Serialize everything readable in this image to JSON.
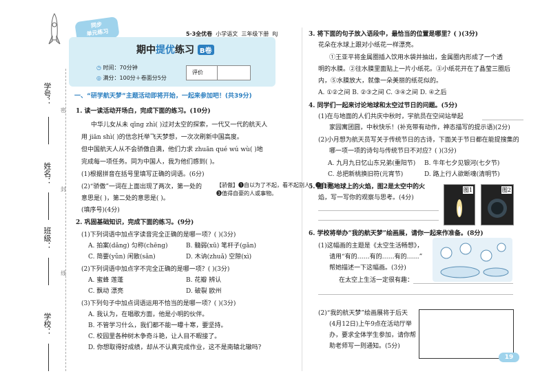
{
  "binding": {
    "student_no": "学号：",
    "name": "姓名：",
    "class": "班级：",
    "school": "学校：",
    "cut_marks": [
      "密",
      "封",
      "线"
    ]
  },
  "header": {
    "badge_line1": "同步",
    "badge_line2": "单元练习",
    "book": "5·3全优卷",
    "subject": "小学语文",
    "grade": "三年级下册",
    "edition": "RJ",
    "title_pre": "期中",
    "title_hl": "提优",
    "title_post": "练习",
    "tag": "B卷",
    "time": "时间：70分钟",
    "score": "满分：100分＋卷面分5分",
    "rating_label": "评价"
  },
  "section": {
    "title": "一、“研学航天梦”主题活动即将开始，一起来参加吧！(共39分)"
  },
  "q1": {
    "stem": "1. 读一读活动开场白，完成下面的练习。(10分)",
    "p1": "中华儿女从未 qīng zhì(        )过对太空的探索，一代又一代的航天人",
    "p2": "用 jiān shì(        )的信念托举飞天梦想，一次次刷新中国高度。",
    "p3": "但中国航天人从不会骄傲自满，他们力求 zhuān qué wú wù(        )地",
    "p4": "完成每一项任务。同为中国人，我为他们感到(        )。",
    "s1": "(1)根据拼音在括号里填写正确的词语。(6分)",
    "s2a": "(2)“骄傲”一词在上面出现了两次，第一处的",
    "s2b": "意思是(     )，第二处的意思是(     )。",
    "s2c": "(填序号)(4分)",
    "s2d": "【骄傲】❶自以为了不起，看不起别人；❷自豪；",
    "s2e": "❸值得自豪的人或事物。"
  },
  "q2": {
    "stem": "2. 巩固基础知识，完成下面的练习。(9分)",
    "s1": "(1)下列词语中加点字读音完全正确的是哪一项？(       )(3分)",
    "s1a": "A. 拍案(dǎng)    匀称(chēng)",
    "s1b": "B. 髓弱(xū)     笔杆子(gǎn)",
    "s1c": "C. 简要(yǔn)    闲散(sǎn)",
    "s1d": "D. 木讷(zhuǎ)   空隙(xì)",
    "s2": "(2)下列词语中加点字不完全正确的是哪一项？(       )(3分)",
    "s2a": "A. 蜜蜂   莲蓬",
    "s2b": "B. 花瓣   辨认",
    "s2c": "C. 飘动   漂亮",
    "s2d": "D. 破裂   欧州",
    "s3": "(3)下列句子中加点词语运用不恰当的是哪一项？(       )(3分)",
    "s3a": "A. 我认为，在唱歌方面，他是小明的伙伴。",
    "s3b": "B. 不管学习什么，我们都不能一曝十寒，要坚持。",
    "s3c": "C. 校园里各种树木争奇斗艳，让人目不暇接了。",
    "s3d": "D. 你想取得好成绩，却从不认真完成作业，这不是南辕北辙吗？"
  },
  "q3": {
    "stem": "3. 将下面的句子放入语段中，最恰当的位置是哪里？(    )(3分)",
    "quote": "花朵在水球上跟对小纸花一样漂亮。",
    "p1": "①王亚平将金属圈插入饮用水袋并抽出，金属圈内形成了一个透",
    "p2": "明的水膜。②往水膜里面贴上一片小纸花。③小纸花开在了晶莹三圈后",
    "p3": "内，⑤水膜放大，就像一朵美丽的纸花似的。",
    "opts": "A. ①②之间     B. ②③之间     C. ③④之间     D. ④之后"
  },
  "q4": {
    "stem": "4. 同学们一起来讨论地球和太空过节日的问题。(5分)",
    "s1a": "(1)在与地面的人们共庆中秋时，宇航员在空间站举起",
    "s1b": "家园寓团圆，中秋快乐！(补充带有动作，神态描写的提示语)(2分)",
    "s2a": "(2)小月想为航天员写关于传统节日的古诗，下面关于节日都在能提搜集的",
    "s2b": "哪一项一项的诗句与传统节日不对应？(    )(3分)",
    "o1": "A. 九月九日忆山东兄弟(重阳节)",
    "o2": "B. 牛年七夕见银河(七夕节)",
    "o3": "C. 总把新桃换旧符(元宵节)",
    "o4": "D. 路上行人欲断魂(清明节)"
  },
  "q5": {
    "stem": "5. 图1是地球上的火焰，图2是太空中的火",
    "line2": "焰，写一写你的观察与思考。(4分)",
    "fig1": "图1",
    "fig2": "图2"
  },
  "q6": {
    "stem": "6. 学校将举办“我的航天梦”绘画展，请你一起来作准备。(8分)",
    "s1a": "(1)这幅画的主题是《太空生活畅想》，",
    "s1b": "请用“有的……有的……有的……”",
    "s1c": "帮她描述一下这幅画。(3分)",
    "s1d": "在太空上生活一定很有趣：",
    "s2a": "(2)“我的航天梦”绘画展将于后天",
    "s2b": "(4月12日)上午9点在活动厅举",
    "s2c": "办，要求全体学生参加，请你帮",
    "s2d": "助老师写一则通知。(5分)"
  },
  "page_no": "19"
}
